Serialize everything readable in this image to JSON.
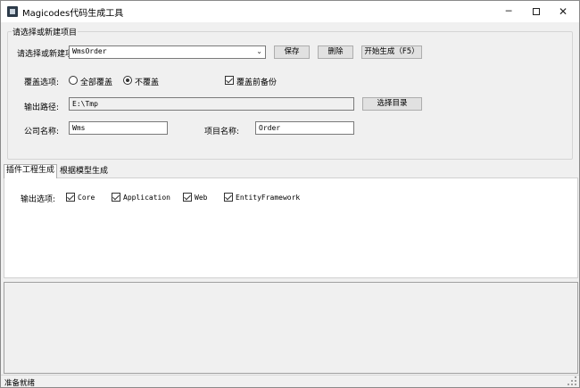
{
  "window": {
    "title": "Magicodes代码生成工具",
    "minimize_glyph": "─",
    "close_glyph": "✕"
  },
  "project_group": {
    "label": "请选择或新建项目",
    "project_label": "请选择或新建项目:",
    "project_value": "WmsOrder",
    "combo_arrow": "⌄",
    "save_button": "保存",
    "delete_button": "删除",
    "generate_button": "开始生成（F5）",
    "overwrite_label": "覆盖选项:",
    "overwrite_all": "全部覆盖",
    "overwrite_none": "不覆盖",
    "backup_label": "覆盖前备份",
    "output_path_label": "输出路径:",
    "output_path_value": "E:\\Tmp",
    "choose_dir_button": "选择目录",
    "company_label": "公司名称:",
    "company_value": "Wms",
    "project_name_label": "项目名称:",
    "project_name_value": "Order"
  },
  "tabs": [
    {
      "label": "插件工程生成"
    },
    {
      "label": "根据模型生成"
    }
  ],
  "output_options": {
    "label": "输出选项:",
    "items": [
      "Core",
      "Application",
      "Web",
      "EntityFramework"
    ]
  },
  "status": {
    "text": "准备就绪"
  }
}
